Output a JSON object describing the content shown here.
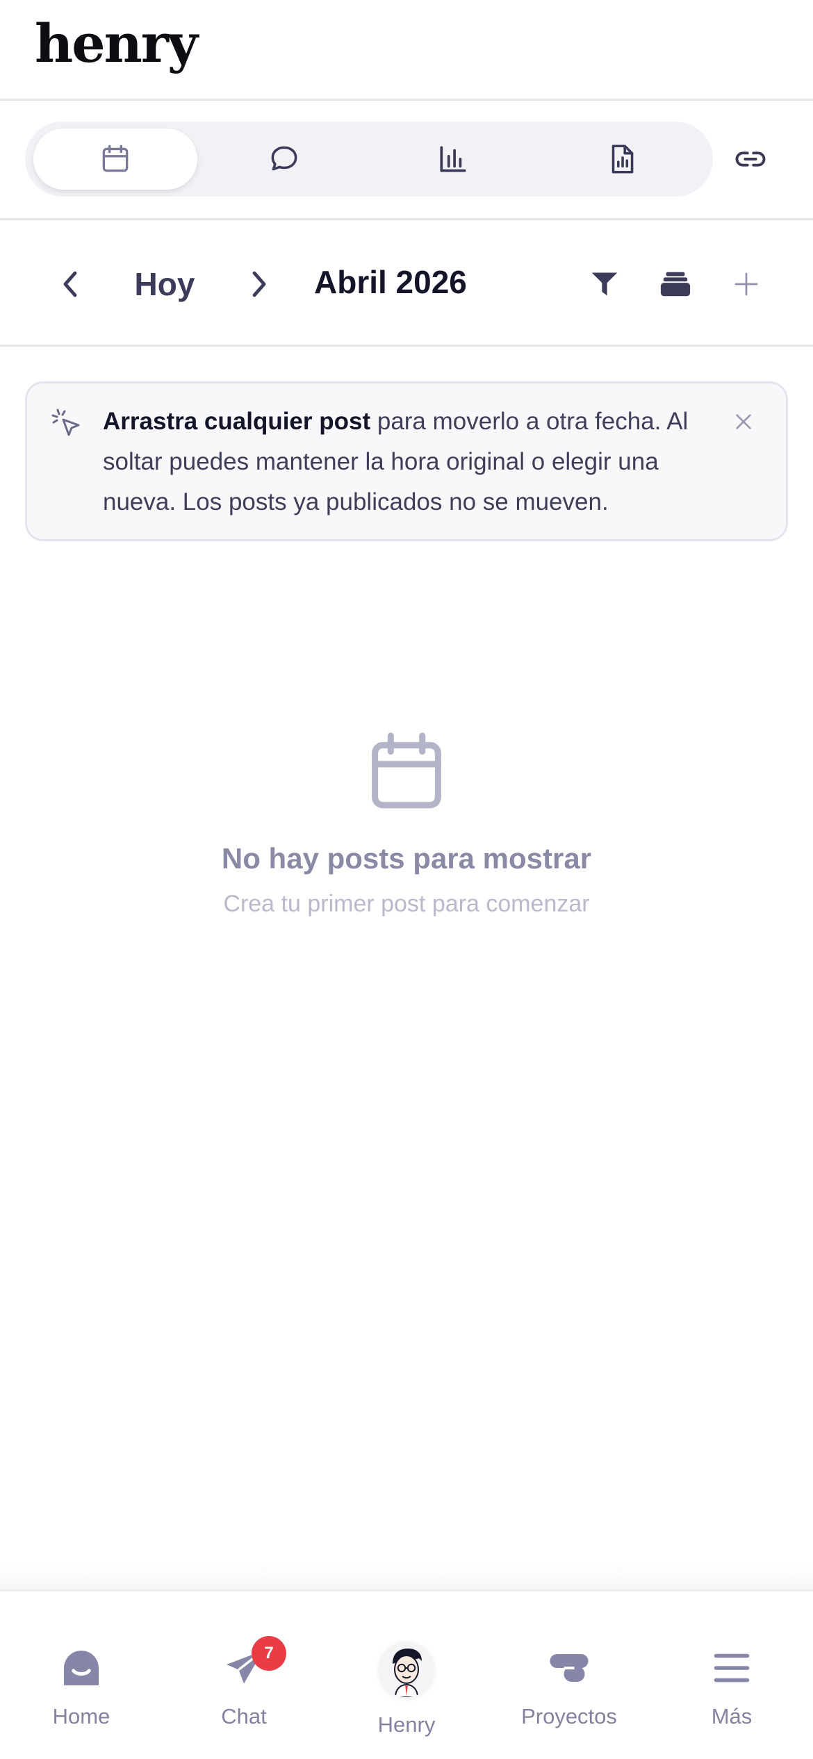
{
  "header": {
    "logo": "henry"
  },
  "tabs": [
    {
      "name": "calendar",
      "icon": "calendar-icon",
      "active": true
    },
    {
      "name": "comments",
      "icon": "chat-bubble-icon",
      "active": false
    },
    {
      "name": "analytics",
      "icon": "bar-chart-icon",
      "active": false
    },
    {
      "name": "report",
      "icon": "report-file-icon",
      "active": false
    }
  ],
  "link_icon": "link-icon",
  "nav": {
    "today_label": "Hoy",
    "month_label": "Abril 2026",
    "prev_icon": "chevron-left-icon",
    "next_icon": "chevron-right-icon",
    "tools": [
      "filter-icon",
      "stack-icon",
      "plus-icon"
    ]
  },
  "banner": {
    "bold_text": "Arrastra cualquier post",
    "text": " para moverlo a otra fecha. Al soltar puedes mantener la hora original o elegir una nueva. Los posts ya publicados no se mueven.",
    "icon": "cursor-click-icon",
    "close_icon": "close-icon"
  },
  "empty_state": {
    "icon": "calendar-icon",
    "title": "No hay posts para mostrar",
    "subtitle": "Crea tu primer post para comenzar"
  },
  "bottom_nav": {
    "home": "Home",
    "chat": "Chat",
    "chat_badge": "7",
    "henry": "Henry",
    "projects": "Proyectos",
    "more": "Más"
  },
  "colors": {
    "accent": "#7c7c9c",
    "badge": "#ea3c45",
    "text_dark": "#15152a"
  }
}
